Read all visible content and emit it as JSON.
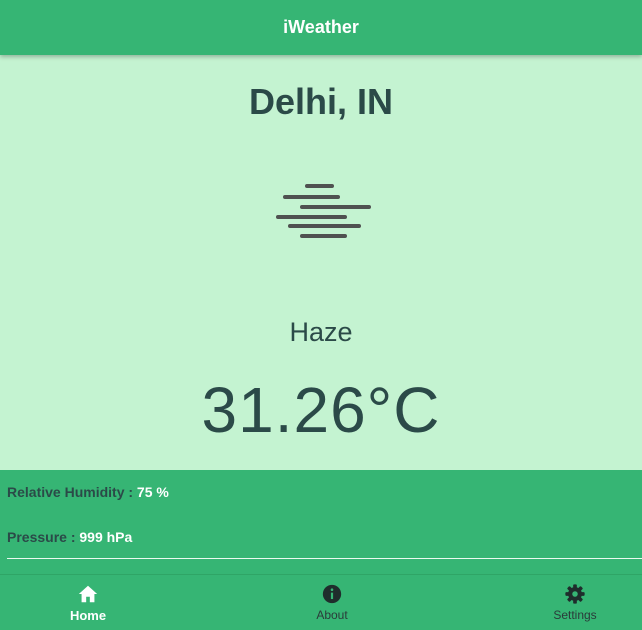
{
  "header": {
    "title": "iWeather"
  },
  "weather": {
    "city": "Delhi, IN",
    "icon": "haze-icon",
    "condition": "Haze",
    "temperature": "31.26°C"
  },
  "details": {
    "humidity_label": "Relative Humidity :",
    "humidity_value": "75 %",
    "pressure_label": "Pressure :",
    "pressure_value": "999 hPa"
  },
  "nav": {
    "items": [
      {
        "label": "Home",
        "icon": "home-icon",
        "active": true
      },
      {
        "label": "About",
        "icon": "info-icon",
        "active": false
      },
      {
        "label": "Settings",
        "icon": "gear-icon",
        "active": false
      }
    ]
  },
  "colors": {
    "primary": "#36b574",
    "background": "#c4f3d1",
    "text_dark": "#2b4a48",
    "text_light": "#ffffff"
  }
}
